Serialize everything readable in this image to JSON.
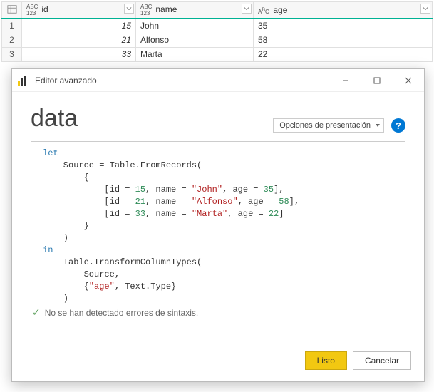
{
  "grid": {
    "columns": [
      {
        "typeTop": "ABC",
        "typeBottom": "123",
        "label": "id"
      },
      {
        "typeTop": "ABC",
        "typeBottom": "123",
        "label": "name"
      },
      {
        "typeTop": "A",
        "typeBottom": "C",
        "superB": "B",
        "label": "age"
      }
    ],
    "rows": [
      {
        "num": "1",
        "id": "15",
        "name": "John",
        "age": "35"
      },
      {
        "num": "2",
        "id": "21",
        "name": "Alfonso",
        "age": "58"
      },
      {
        "num": "3",
        "id": "33",
        "name": "Marta",
        "age": "22"
      }
    ]
  },
  "dialog": {
    "title": "Editor avanzado",
    "heading": "data",
    "options_label": "Opciones de presentación",
    "status": "No se han detectado errores de sintaxis.",
    "ok": "Listo",
    "cancel": "Cancelar"
  },
  "code": {
    "let": "let",
    "l1a": "    Source = Table.FromRecords(",
    "l2": "        {",
    "r1a": "            [id = ",
    "r1id": "15",
    "r1b": ", name = ",
    "r1name": "\"John\"",
    "r1c": ", age = ",
    "r1age": "35",
    "r1d": "],",
    "r2a": "            [id = ",
    "r2id": "21",
    "r2b": ", name = ",
    "r2name": "\"Alfonso\"",
    "r2c": ", age = ",
    "r2age": "58",
    "r2d": "],",
    "r3a": "            [id = ",
    "r3id": "33",
    "r3b": ", name = ",
    "r3name": "\"Marta\"",
    "r3c": ", age = ",
    "r3age": "22",
    "r3d": "]",
    "l6": "        }",
    "l7": "    )",
    "in": "in",
    "l8": "    Table.TransformColumnTypes(",
    "l9": "        Source,",
    "l10a": "        {",
    "l10b": "\"age\"",
    "l10c": ", Text.Type}",
    "l11": "    )"
  }
}
